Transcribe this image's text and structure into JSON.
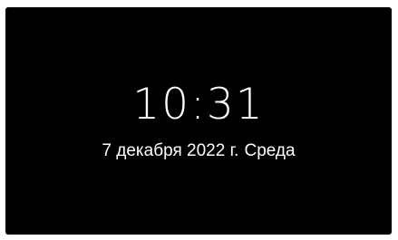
{
  "lockscreen": {
    "time": "10:31",
    "date": "7 декабря 2022 г.",
    "weekday": "Среда"
  },
  "colors": {
    "background": "#000000",
    "text": "#ffffff"
  }
}
